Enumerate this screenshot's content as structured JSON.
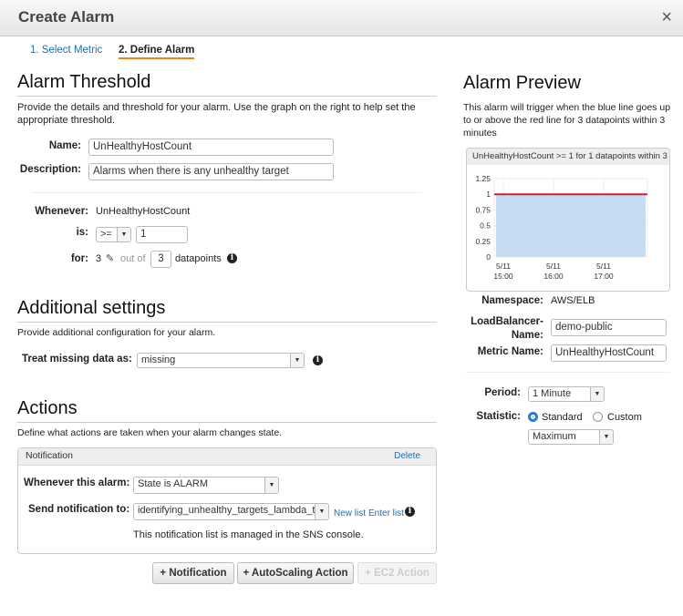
{
  "dialog": {
    "title": "Create Alarm",
    "close": "×"
  },
  "tabs": [
    {
      "label": "1. Select Metric"
    },
    {
      "label": "2. Define Alarm"
    }
  ],
  "threshold": {
    "heading": "Alarm Threshold",
    "desc": "Provide the details and threshold for your alarm. Use the graph on the right to help set the appropriate threshold.",
    "name_label": "Name:",
    "name_value": "UnHealthyHostCount",
    "desc_label": "Description:",
    "desc_value": "Alarms when there is any unhealthy target",
    "whenever_label": "Whenever:",
    "whenever_value": "UnHealthyHostCount",
    "is_label": "is:",
    "operator": ">=",
    "threshold_value": "1",
    "for_label": "for:",
    "for_value": "3",
    "out_of": "out of",
    "datapoints_value": "3",
    "datapoints_label": "datapoints"
  },
  "additional": {
    "heading": "Additional settings",
    "desc": "Provide additional configuration for your alarm.",
    "missing_label": "Treat missing data as:",
    "missing_value": "missing"
  },
  "actions": {
    "heading": "Actions",
    "desc": "Define what actions are taken when your alarm changes state.",
    "panel_title": "Notification",
    "delete": "Delete",
    "whenever_label": "Whenever this alarm:",
    "state_value": "State is ALARM",
    "send_label": "Send notification to:",
    "send_value": "identifying_unhealthy_targets_lambda_t",
    "new_list": "New list",
    "enter_list": "Enter list",
    "sns_note": "This notification list is managed in the SNS console.",
    "buttons": {
      "notification": "+ Notification",
      "autoscaling": "+ AutoScaling Action",
      "ec2": "+ EC2 Action"
    }
  },
  "preview": {
    "heading": "Alarm Preview",
    "desc": "This alarm will trigger when the blue line goes up to or above the red line for 3 datapoints within 3 minutes",
    "namespace_label": "Namespace:",
    "namespace_value": "AWS/ELB",
    "lb_label": "LoadBalancer-Name:",
    "lb_value": "demo-public",
    "metric_label": "Metric Name:",
    "metric_value": "UnHealthyHostCount",
    "period_label": "Period:",
    "period_value": "1 Minute",
    "statistic_label": "Statistic:",
    "standard": "Standard",
    "custom": "Custom",
    "statistic_value": "Maximum"
  },
  "chart_data": {
    "type": "area",
    "title": "UnHealthyHostCount >= 1 for 1 datapoints within 3 ...",
    "ylim": [
      0,
      1.25
    ],
    "yticks": [
      "1.25",
      "1",
      "0.75",
      "0.5",
      "0.25",
      "0"
    ],
    "xticks": [
      {
        "d": "5/11",
        "t": "15:00"
      },
      {
        "d": "5/11",
        "t": "16:00"
      },
      {
        "d": "5/11",
        "t": "17:00"
      }
    ],
    "series": [
      {
        "values": [
          1,
          1,
          1,
          1,
          1,
          1,
          1
        ]
      }
    ],
    "threshold": 1,
    "colors": {
      "area": "#c5dcf2",
      "threshold": "#d0202e"
    }
  }
}
